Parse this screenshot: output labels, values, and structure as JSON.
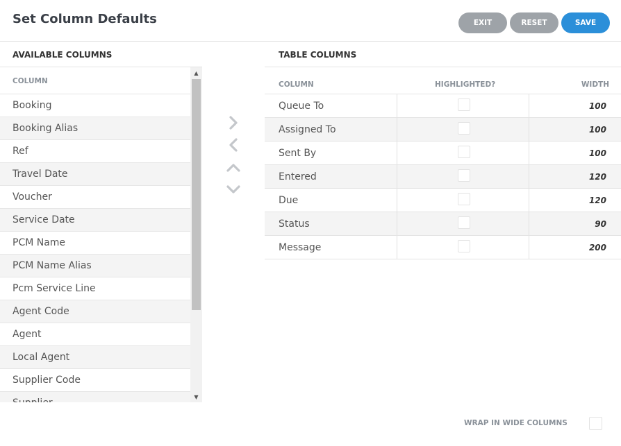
{
  "header": {
    "title": "Set Column Defaults",
    "exit_label": "EXIT",
    "reset_label": "RESET",
    "save_label": "SAVE"
  },
  "available": {
    "title": "AVAILABLE COLUMNS",
    "column_header": "COLUMN",
    "items": [
      "Booking",
      "Booking Alias",
      "Ref",
      "Travel Date",
      "Voucher",
      "Service Date",
      "PCM Name",
      "PCM Name Alias",
      "Pcm Service Line",
      "Agent Code",
      "Agent",
      "Local Agent",
      "Supplier Code",
      "Supplier"
    ]
  },
  "move_controls": [
    "chevron-right-icon",
    "chevron-left-icon",
    "chevron-up-icon",
    "chevron-down-icon"
  ],
  "table": {
    "title": "TABLE COLUMNS",
    "headers": {
      "column": "COLUMN",
      "highlighted": "HIGHLIGHTED?",
      "width": "WIDTH"
    },
    "rows": [
      {
        "column": "Queue To",
        "highlighted": false,
        "width": "100"
      },
      {
        "column": "Assigned To",
        "highlighted": false,
        "width": "100"
      },
      {
        "column": "Sent By",
        "highlighted": false,
        "width": "100"
      },
      {
        "column": "Entered",
        "highlighted": false,
        "width": "120"
      },
      {
        "column": "Due",
        "highlighted": false,
        "width": "120"
      },
      {
        "column": "Status",
        "highlighted": false,
        "width": "90"
      },
      {
        "column": "Message",
        "highlighted": false,
        "width": "200"
      }
    ]
  },
  "options": {
    "wrap_label": "WRAP IN WIDE COLUMNS",
    "wrap_checked": false
  },
  "colors": {
    "accent": "#2b8fd9",
    "button_gray": "#9ea3a8"
  }
}
